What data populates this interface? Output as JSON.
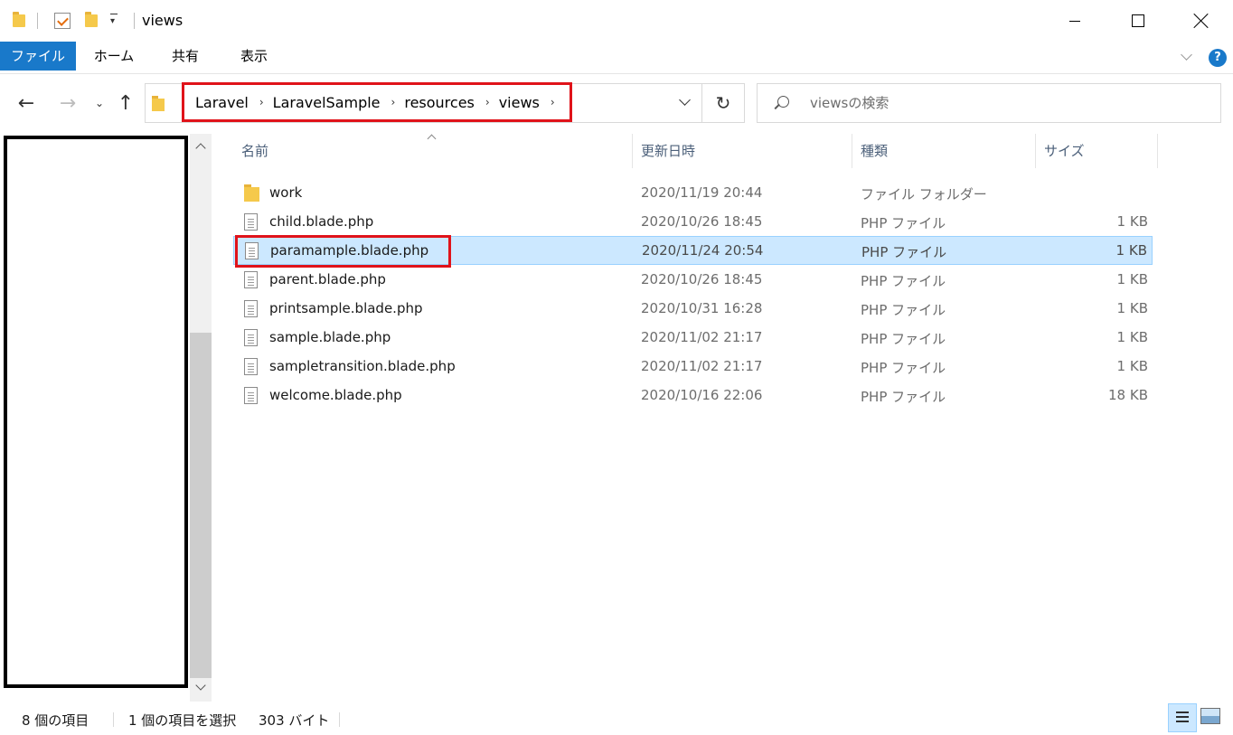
{
  "window": {
    "title": "views",
    "quick_access_dropdown": "▾"
  },
  "ribbon": {
    "tabs": [
      "ファイル",
      "ホーム",
      "共有",
      "表示"
    ],
    "help": "?"
  },
  "navigation": {
    "back": "←",
    "forward": "→",
    "recent": "⌄",
    "up": "↑",
    "refresh": "↻",
    "breadcrumb": [
      "Laravel",
      "LaravelSample",
      "resources",
      "views"
    ],
    "breadcrumb_separator": "›"
  },
  "search": {
    "placeholder": "viewsの検索",
    "value": ""
  },
  "columns": {
    "name": "名前",
    "date": "更新日時",
    "type": "種類",
    "size": "サイズ"
  },
  "files": [
    {
      "name": "work",
      "date": "2020/11/19 20:44",
      "type": "ファイル フォルダー",
      "size": "",
      "icon": "folder-icon"
    },
    {
      "name": "child.blade.php",
      "date": "2020/10/26 18:45",
      "type": "PHP ファイル",
      "size": "1 KB",
      "icon": "file-icon"
    },
    {
      "name": "paramample.blade.php",
      "date": "2020/11/24 20:54",
      "type": "PHP ファイル",
      "size": "1 KB",
      "icon": "file-icon",
      "selected": true
    },
    {
      "name": "parent.blade.php",
      "date": "2020/10/26 18:45",
      "type": "PHP ファイル",
      "size": "1 KB",
      "icon": "file-icon"
    },
    {
      "name": "printsample.blade.php",
      "date": "2020/10/31 16:28",
      "type": "PHP ファイル",
      "size": "1 KB",
      "icon": "file-icon"
    },
    {
      "name": "sample.blade.php",
      "date": "2020/11/02 21:17",
      "type": "PHP ファイル",
      "size": "1 KB",
      "icon": "file-icon"
    },
    {
      "name": "sampletransition.blade.php",
      "date": "2020/11/02 21:17",
      "type": "PHP ファイル",
      "size": "1 KB",
      "icon": "file-icon"
    },
    {
      "name": "welcome.blade.php",
      "date": "2020/10/16 22:06",
      "type": "PHP ファイル",
      "size": "18 KB",
      "icon": "file-icon"
    }
  ],
  "status": {
    "item_count": "8 個の項目",
    "selected": "1 個の項目を選択",
    "selected_size": "303 バイト"
  },
  "colors": {
    "file_tab": "#1979ca",
    "selection": "#cce8ff",
    "annotation_red": "#e0131a"
  }
}
